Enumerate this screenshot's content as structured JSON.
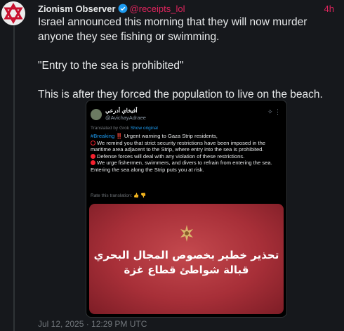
{
  "tweet": {
    "author_name": "Zionism Observer",
    "handle": "@receipts_lol",
    "time": "4h",
    "text": "Israel announced this morning that they will now murder anyone they see fishing or swimming.\n\n\"Entry to the sea is prohibited\"\n\nThis is after they forced the population to live on the beach.",
    "footer": "Jul 12, 2025 · 12:29 PM UTC"
  },
  "embed": {
    "name": "أفيخاي أدرعي",
    "handle": "@AvichayAdraee",
    "translated_label": "Translated by Grok",
    "show_original": "Show original",
    "hashtag": "#Breaking",
    "bang": "‼️",
    "line1": "Urgent warning to Gaza Strip residents,",
    "line2": "We remind you that strict security restrictions have been imposed in the maritime area adjacent to the Strip, where entry into the sea is prohibited.",
    "line3": "Defense forces will deal with any violation of these restrictions.",
    "line4": "We urge fishermen, swimmers, and divers to refrain from entering the sea. Entering the sea along the Strip puts you at risk.",
    "rate": "Rate this translation:",
    "banner_line1": "تحذير خطير بخصوص المجال البحري",
    "banner_line2": "قبالة شواطئ قطاع غزة"
  },
  "colors": {
    "handle": "#e0245e",
    "accent_blue": "#1d9bf0",
    "banner_red": "#a72f38"
  },
  "icons": {
    "avatar": "star-of-david-avatar",
    "verified": "verified-badge-icon",
    "grok": "grok-icon",
    "thumbs": "thumbs-up-down-icons",
    "emblem": "idf-emblem"
  }
}
